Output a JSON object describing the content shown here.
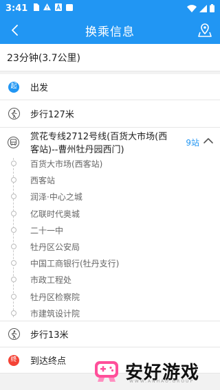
{
  "status_bar": {
    "time": "3:41",
    "icons": [
      "sim-icon",
      "alert-icon",
      "a-icon",
      "square-icon"
    ],
    "right_icons": [
      "wifi-icon",
      "signal-icon",
      "battery-icon"
    ]
  },
  "app_bar": {
    "title": "换乘信息",
    "back_icon": "back-arrow-icon",
    "map_icon": "map-pin-icon",
    "bg_color": "#2196f3"
  },
  "summary": "23分钟(3.7公里)",
  "steps": {
    "start": {
      "badge": "起",
      "label": "出发"
    },
    "walk1": {
      "label": "步行127米"
    },
    "bus": {
      "line": "赏花专线2712号线(百货大市场(西客站)--曹州牡丹园西门)",
      "stops_count": "9站",
      "stops": [
        "百货大市场(西客站)",
        "西客站",
        "润泽·中心之城",
        "亿联时代奥城",
        "二十一中",
        "牡丹区公安局",
        "中国工商银行(牡丹支行)",
        "市政工程处",
        "牡丹区检察院",
        "市建筑设计院"
      ]
    },
    "walk2": {
      "label": "步行13米"
    },
    "end": {
      "badge": "终",
      "label": "到达终点"
    }
  },
  "watermark": {
    "text": "安好游戏",
    "sub": "WWW.ANHAO.GROUP"
  }
}
